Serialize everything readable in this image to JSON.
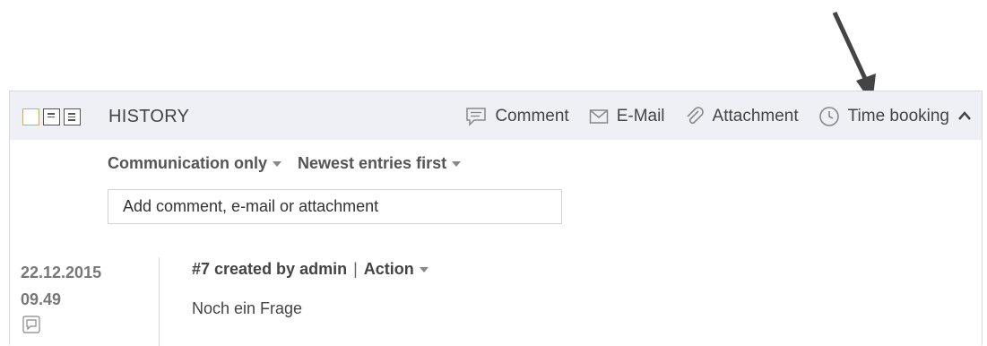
{
  "header": {
    "title": "HISTORY",
    "actions": {
      "comment": "Comment",
      "email": "E-Mail",
      "attachment": "Attachment",
      "time_booking": "Time booking"
    }
  },
  "filters": {
    "scope": "Communication only",
    "order": "Newest entries first"
  },
  "composer": {
    "placeholder": "Add comment, e-mail or attachment"
  },
  "entries": [
    {
      "date": "22.12.2015",
      "time": "09.49",
      "title": "#7 created by admin",
      "separator": "|",
      "action_label": "Action",
      "body": "Noch ein Frage"
    }
  ],
  "colors": {
    "header_bg": "#eef0f5",
    "active_view": "#f0a52e"
  }
}
